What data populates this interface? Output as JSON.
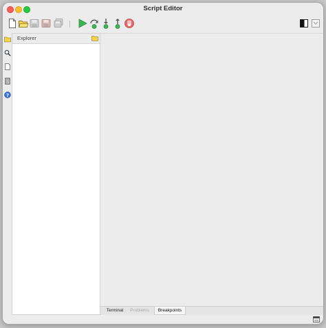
{
  "window": {
    "title": "Script Editor",
    "controls": {
      "close": "close-button",
      "minimize": "minimize-button",
      "maximize": "maximize-button"
    }
  },
  "toolbar": {
    "icons": [
      "new-file-icon",
      "open-folder-icon",
      "save-icon",
      "save-as-icon",
      "save-all-icon",
      "run-icon",
      "step-over-icon",
      "step-into-icon",
      "step-out-icon",
      "stop-icon",
      "toggle-panel-icon",
      "collapse-panel-icon"
    ],
    "disabled": [
      "save-icon",
      "save-as-icon",
      "save-all-icon"
    ]
  },
  "sidebar": {
    "icons": [
      "folder-icon",
      "search-icon",
      "document-icon",
      "book-icon",
      "help-icon"
    ],
    "active": "folder-icon"
  },
  "explorer": {
    "title": "Explorer",
    "items": []
  },
  "tabs": [
    {
      "label": "Terminal",
      "state": "normal"
    },
    {
      "label": "Problems",
      "state": "disabled"
    },
    {
      "label": "Breakpoints",
      "state": "selected"
    }
  ],
  "statusbar": {
    "icons": [
      "layout-icon"
    ]
  },
  "colors": {
    "window_bg": "#ececec",
    "explorer_bg": "#ffffff",
    "run_green": "#3cb454",
    "stop_red": "#e46a6a",
    "folder_yellow": "#f3d34a",
    "help_blue": "#3a6fd8"
  }
}
